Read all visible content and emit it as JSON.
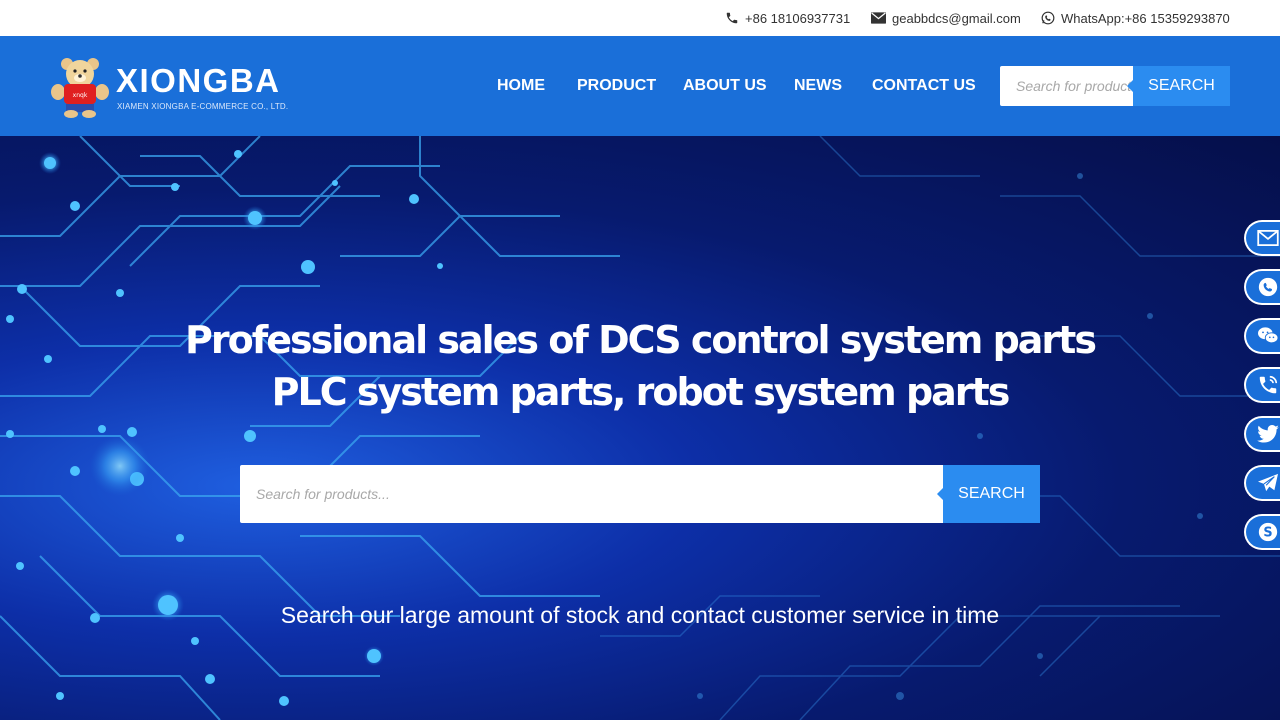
{
  "topbar": {
    "phone": "+86 18106937731",
    "email": "geabbdcs@gmail.com",
    "whatsapp": "WhatsApp:+86 15359293870"
  },
  "header": {
    "brand": "XIONGBA",
    "subtitle": "XIAMEN XIONGBA E-COMMERCE CO., LTD.",
    "nav": [
      "HOME",
      "PRODUCT",
      "ABOUT US",
      "NEWS",
      "CONTACT US"
    ],
    "search_placeholder": "Search for products...",
    "search_button": "SEARCH"
  },
  "hero": {
    "title_line1": "Professional sales of DCS control system parts",
    "title_line2": "PLC system parts, robot system parts",
    "search_placeholder": "Search for products...",
    "search_button": "SEARCH",
    "subtitle": "Search our large amount of stock and contact customer service in time"
  },
  "social": [
    "email-icon",
    "whatsapp-icon",
    "wechat-icon",
    "phone-icon",
    "twitter-icon",
    "telegram-icon",
    "skype-icon"
  ],
  "colors": {
    "header_bg": "#1a6fd9",
    "button": "#2b8cf0",
    "hero_dark": "#050f4a"
  }
}
